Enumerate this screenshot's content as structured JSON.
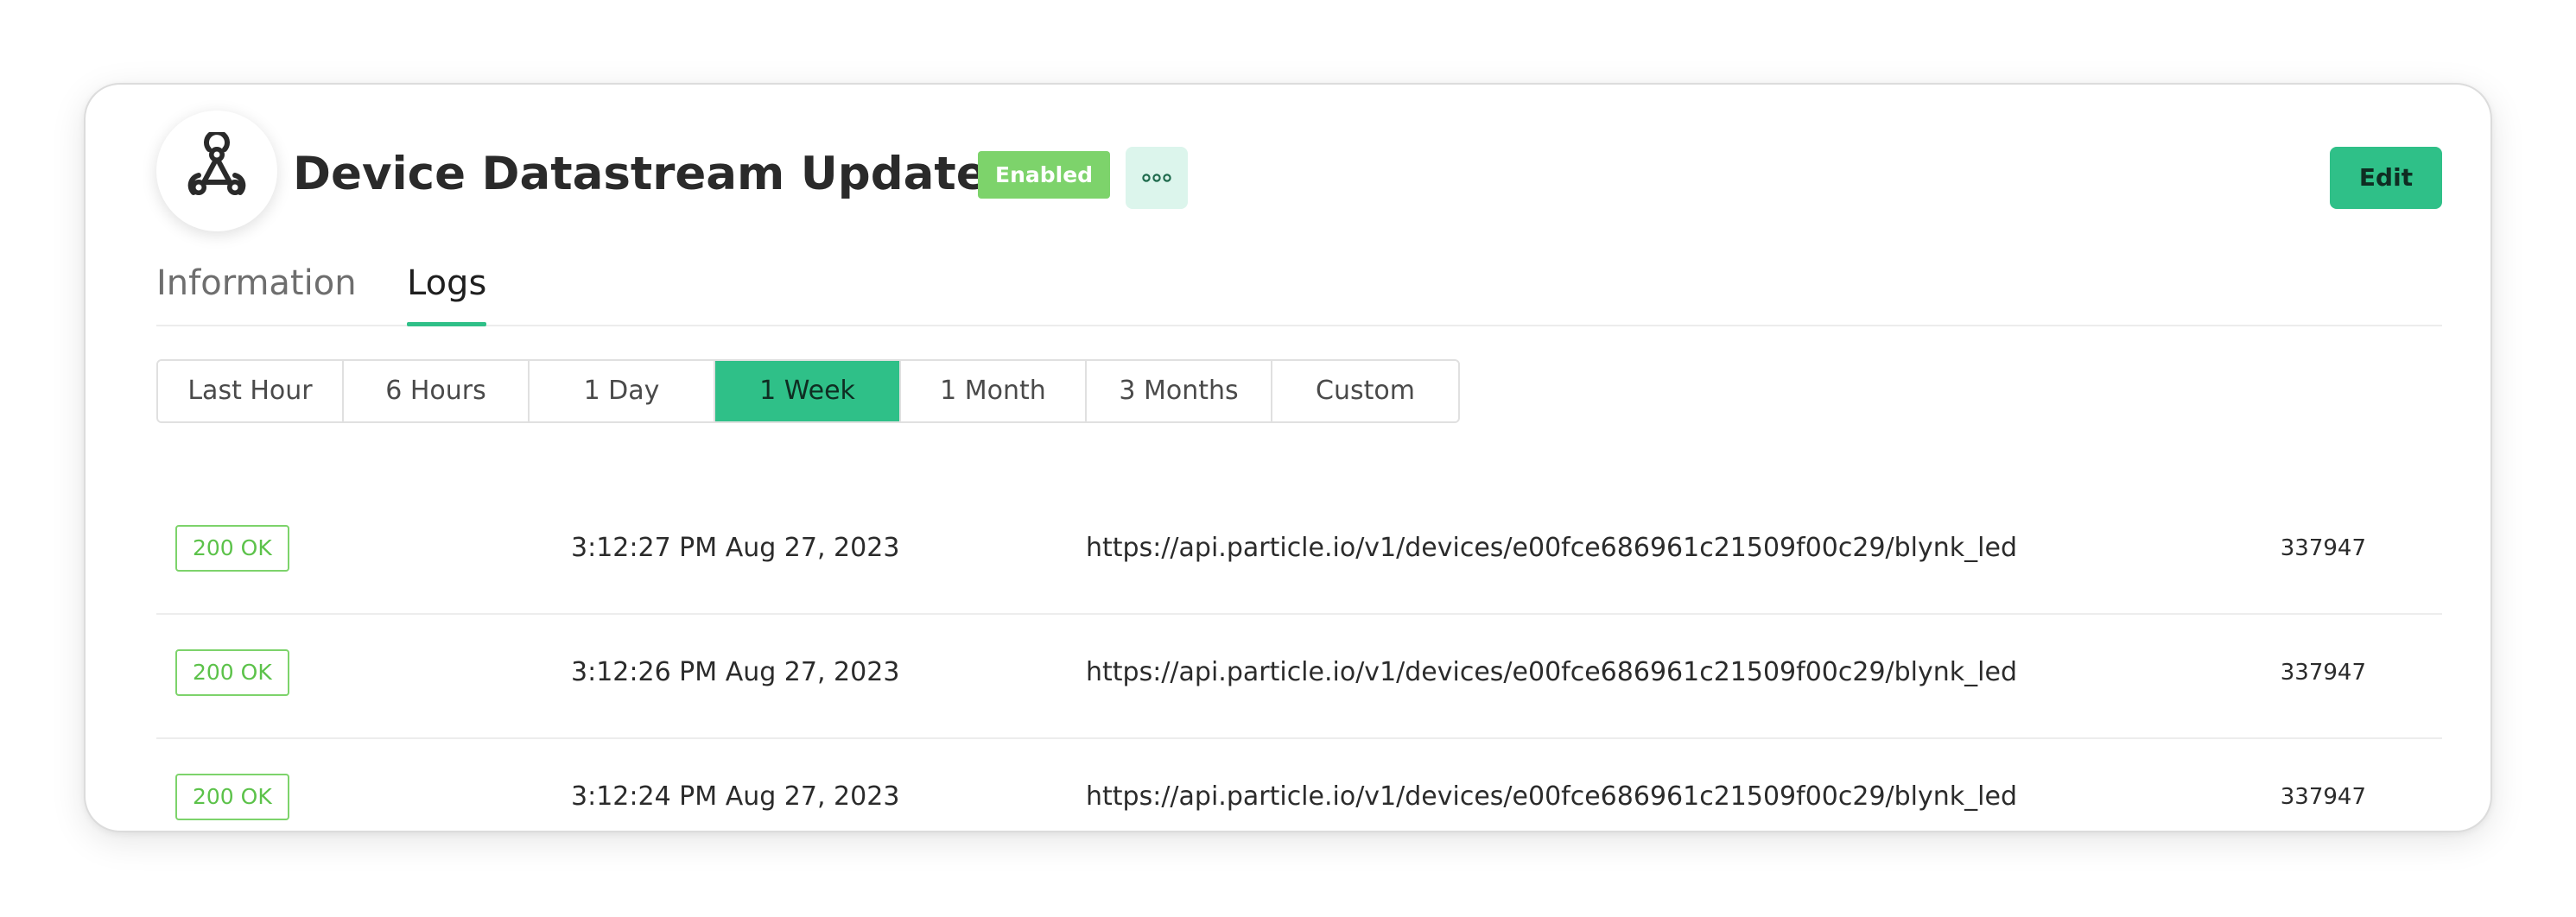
{
  "header": {
    "logo_icon": "webhook-icon",
    "title": "Device Datastream Update",
    "status_badge": "Enabled",
    "more_icon": "more-dots-icon",
    "edit_label": "Edit"
  },
  "tabs": [
    {
      "label": "Information",
      "active": false
    },
    {
      "label": "Logs",
      "active": true
    }
  ],
  "time_ranges": [
    {
      "label": "Last Hour",
      "active": false
    },
    {
      "label": "6 Hours",
      "active": false
    },
    {
      "label": "1 Day",
      "active": false
    },
    {
      "label": "1 Week",
      "active": true
    },
    {
      "label": "1 Month",
      "active": false
    },
    {
      "label": "3 Months",
      "active": false
    },
    {
      "label": "Custom",
      "active": false
    }
  ],
  "logs": [
    {
      "status": "200 OK",
      "time": "3:12:27 PM Aug 27, 2023",
      "url": "https://api.particle.io/v1/devices/e00fce686961c21509f00c29/blynk_led",
      "id": "337947"
    },
    {
      "status": "200 OK",
      "time": "3:12:26 PM Aug 27, 2023",
      "url": "https://api.particle.io/v1/devices/e00fce686961c21509f00c29/blynk_led",
      "id": "337947"
    },
    {
      "status": "200 OK",
      "time": "3:12:24 PM Aug 27, 2023",
      "url": "https://api.particle.io/v1/devices/e00fce686961c21509f00c29/blynk_led",
      "id": "337947"
    }
  ],
  "colors": {
    "accent": "#2fc088",
    "status_green": "#7dd36b",
    "more_button_bg": "#dcf5ec"
  }
}
